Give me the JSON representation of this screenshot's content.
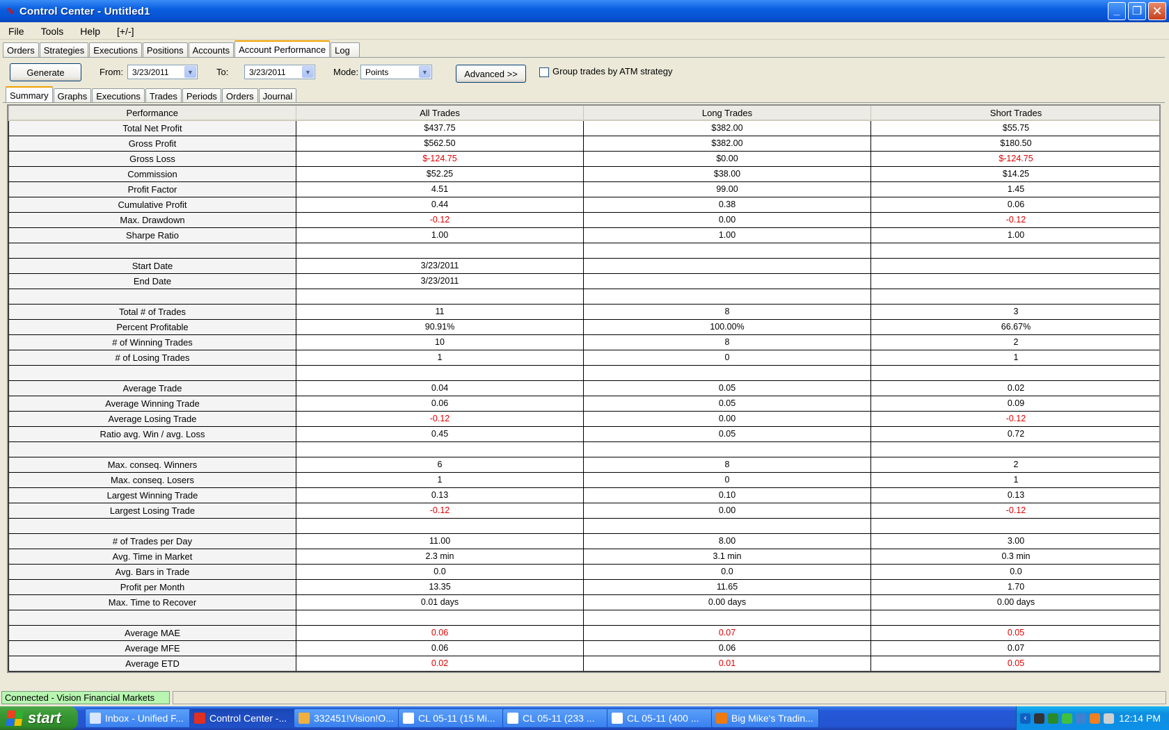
{
  "window": {
    "title": "Control Center - Untitled1",
    "minimize": "_",
    "maximize": "❐",
    "close": "✕"
  },
  "menu": [
    "File",
    "Tools",
    "Help",
    "[+/-]"
  ],
  "top_tabs": [
    "Orders",
    "Strategies",
    "Executions",
    "Positions",
    "Accounts",
    "Account Performance",
    "Log"
  ],
  "toolbar": {
    "generate_label": "Generate",
    "from_label": "From:",
    "from_value": "3/23/2011",
    "to_label": "To:",
    "to_value": "3/23/2011",
    "mode_label": "Mode:",
    "mode_value": "Points",
    "advanced_label": "Advanced >>",
    "group_label": "Group trades by ATM strategy"
  },
  "sub_tabs": [
    "Summary",
    "Graphs",
    "Executions",
    "Trades",
    "Periods",
    "Orders",
    "Journal"
  ],
  "grid": {
    "headers": [
      "Performance",
      "All Trades",
      "Long Trades",
      "Short Trades"
    ],
    "rows": [
      {
        "label": "Total Net Profit",
        "all": "$437.75",
        "long": "$382.00",
        "short": "$55.75",
        "neg": []
      },
      {
        "label": "Gross Profit",
        "all": "$562.50",
        "long": "$382.00",
        "short": "$180.50",
        "neg": []
      },
      {
        "label": "Gross Loss",
        "all": "$-124.75",
        "long": "$0.00",
        "short": "$-124.75",
        "neg": [
          "all",
          "short"
        ]
      },
      {
        "label": "Commission",
        "all": "$52.25",
        "long": "$38.00",
        "short": "$14.25",
        "neg": []
      },
      {
        "label": "Profit Factor",
        "all": "4.51",
        "long": "99.00",
        "short": "1.45",
        "neg": []
      },
      {
        "label": "Cumulative Profit",
        "all": "0.44",
        "long": "0.38",
        "short": "0.06",
        "neg": []
      },
      {
        "label": "Max. Drawdown",
        "all": "-0.12",
        "long": "0.00",
        "short": "-0.12",
        "neg": [
          "all",
          "short"
        ]
      },
      {
        "label": "Sharpe Ratio",
        "all": "1.00",
        "long": "1.00",
        "short": "1.00",
        "neg": []
      },
      {
        "label": "",
        "all": "",
        "long": "",
        "short": "",
        "neg": []
      },
      {
        "label": "Start Date",
        "all": "3/23/2011",
        "long": "",
        "short": "",
        "neg": []
      },
      {
        "label": "End Date",
        "all": "3/23/2011",
        "long": "",
        "short": "",
        "neg": []
      },
      {
        "label": "",
        "all": "",
        "long": "",
        "short": "",
        "neg": []
      },
      {
        "label": "Total # of Trades",
        "all": "11",
        "long": "8",
        "short": "3",
        "neg": []
      },
      {
        "label": "Percent Profitable",
        "all": "90.91%",
        "long": "100.00%",
        "short": "66.67%",
        "neg": []
      },
      {
        "label": "# of Winning Trades",
        "all": "10",
        "long": "8",
        "short": "2",
        "neg": []
      },
      {
        "label": "# of Losing Trades",
        "all": "1",
        "long": "0",
        "short": "1",
        "neg": []
      },
      {
        "label": "",
        "all": "",
        "long": "",
        "short": "",
        "neg": []
      },
      {
        "label": "Average Trade",
        "all": "0.04",
        "long": "0.05",
        "short": "0.02",
        "neg": []
      },
      {
        "label": "Average Winning Trade",
        "all": "0.06",
        "long": "0.05",
        "short": "0.09",
        "neg": []
      },
      {
        "label": "Average Losing Trade",
        "all": "-0.12",
        "long": "0.00",
        "short": "-0.12",
        "neg": [
          "all",
          "short"
        ]
      },
      {
        "label": "Ratio avg. Win / avg. Loss",
        "all": "0.45",
        "long": "0.05",
        "short": "0.72",
        "neg": []
      },
      {
        "label": "",
        "all": "",
        "long": "",
        "short": "",
        "neg": []
      },
      {
        "label": "Max. conseq. Winners",
        "all": "6",
        "long": "8",
        "short": "2",
        "neg": []
      },
      {
        "label": "Max. conseq. Losers",
        "all": "1",
        "long": "0",
        "short": "1",
        "neg": []
      },
      {
        "label": "Largest Winning Trade",
        "all": "0.13",
        "long": "0.10",
        "short": "0.13",
        "neg": []
      },
      {
        "label": "Largest Losing Trade",
        "all": "-0.12",
        "long": "0.00",
        "short": "-0.12",
        "neg": [
          "all",
          "short"
        ]
      },
      {
        "label": "",
        "all": "",
        "long": "",
        "short": "",
        "neg": []
      },
      {
        "label": "# of Trades per Day",
        "all": "11.00",
        "long": "8.00",
        "short": "3.00",
        "neg": []
      },
      {
        "label": "Avg. Time in Market",
        "all": "2.3 min",
        "long": "3.1 min",
        "short": "0.3 min",
        "neg": []
      },
      {
        "label": "Avg. Bars in Trade",
        "all": "0.0",
        "long": "0.0",
        "short": "0.0",
        "neg": []
      },
      {
        "label": "Profit per Month",
        "all": "13.35",
        "long": "11.65",
        "short": "1.70",
        "neg": []
      },
      {
        "label": "Max. Time to Recover",
        "all": "0.01 days",
        "long": "0.00 days",
        "short": "0.00 days",
        "neg": []
      },
      {
        "label": "",
        "all": "",
        "long": "",
        "short": "",
        "neg": []
      },
      {
        "label": "Average MAE",
        "all": "0.06",
        "long": "0.07",
        "short": "0.05",
        "neg": [
          "all",
          "long",
          "short"
        ]
      },
      {
        "label": "Average MFE",
        "all": "0.06",
        "long": "0.06",
        "short": "0.07",
        "neg": []
      },
      {
        "label": "Average ETD",
        "all": "0.02",
        "long": "0.01",
        "short": "0.05",
        "neg": [
          "all",
          "long",
          "short"
        ]
      }
    ]
  },
  "status": {
    "connection": "Connected - Vision Financial Markets"
  },
  "taskbar": {
    "start_label": "start",
    "items": [
      {
        "label": "Inbox - Unified F...",
        "icon": "mail-icon",
        "color": "#d8e6ff"
      },
      {
        "label": "Control Center -...",
        "icon": "ninjatrader-icon",
        "color": "#e03020"
      },
      {
        "label": "332451!Vision!O...",
        "icon": "grid-icon",
        "color": "#f0b040"
      },
      {
        "label": "CL 05-11 (15 Mi...",
        "icon": "chart-icon",
        "color": "#ffffff"
      },
      {
        "label": "CL 05-11 (233 ...",
        "icon": "chart-icon",
        "color": "#ffffff"
      },
      {
        "label": "CL 05-11 (400 ...",
        "icon": "chart-icon",
        "color": "#ffffff"
      },
      {
        "label": "Big Mike's Tradin...",
        "icon": "firefox-icon",
        "color": "#f07a10"
      }
    ],
    "time": "12:14 PM"
  },
  "colors": {
    "negative": "#e00000",
    "active_tab_accent": "#f0a000",
    "connected_bg": "#b7f5b0"
  }
}
